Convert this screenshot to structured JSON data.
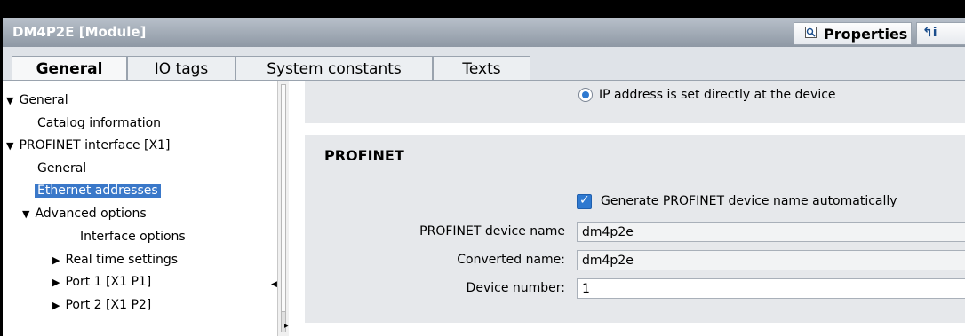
{
  "window": {
    "title": "DM4P2E [Module]"
  },
  "toolbar": {
    "properties_label": "Properties",
    "info_label": "i"
  },
  "tabs": [
    {
      "label": "General"
    },
    {
      "label": "IO tags"
    },
    {
      "label": "System constants"
    },
    {
      "label": "Texts"
    }
  ],
  "tree": {
    "items": [
      {
        "label": "General",
        "expanded": true
      },
      {
        "label": "Catalog information"
      },
      {
        "label": "PROFINET interface [X1]",
        "expanded": true
      },
      {
        "label": "General"
      },
      {
        "label": "Ethernet addresses",
        "selected": true
      },
      {
        "label": "Advanced options",
        "expanded": true
      },
      {
        "label": "Interface options"
      },
      {
        "label": "Real time settings",
        "expanded": false
      },
      {
        "label": "Port 1 [X1 P1]",
        "expanded": false
      },
      {
        "label": "Port 2 [X1 P2]",
        "expanded": false
      }
    ]
  },
  "ip_section": {
    "radio_label": "IP address is set directly at the device",
    "radio_selected": true
  },
  "profinet": {
    "title": "PROFINET",
    "auto_name_label": "Generate PROFINET device name automatically",
    "auto_name_checked": true,
    "device_name_label": "PROFINET device name",
    "device_name_value": "dm4p2e",
    "converted_name_label": "Converted name:",
    "converted_name_value": "dm4p2e",
    "device_number_label": "Device number:",
    "device_number_value": "1"
  },
  "colors": {
    "selection": "#3a78c9",
    "accent": "#2f79d0",
    "titlebar": "#a3acb7"
  }
}
